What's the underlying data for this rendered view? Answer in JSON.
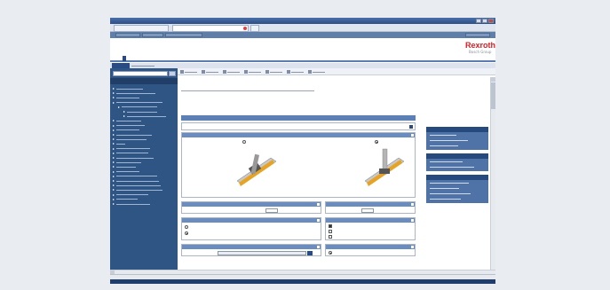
{
  "window": {
    "title": "",
    "tabs": [
      "",
      ""
    ]
  },
  "bookmarks": [
    "",
    "",
    "",
    ""
  ],
  "header": {
    "brand": "Rexroth",
    "brand_sub": "Bosch Group"
  },
  "main_nav": [
    "",
    "",
    "",
    "",
    ""
  ],
  "left_panel": {
    "search_value": "",
    "heading": "",
    "items": [
      {
        "level": 0
      },
      {
        "level": 0
      },
      {
        "level": 0
      },
      {
        "level": 0
      },
      {
        "level": 1
      },
      {
        "level": 2
      },
      {
        "level": 2
      },
      {
        "level": 0
      },
      {
        "level": 0
      },
      {
        "level": 0
      },
      {
        "level": 0
      },
      {
        "level": 0
      },
      {
        "level": 0
      },
      {
        "level": 0
      },
      {
        "level": 0
      },
      {
        "level": 0
      },
      {
        "level": 0
      },
      {
        "level": 0
      },
      {
        "level": 0
      },
      {
        "level": 0
      },
      {
        "level": 0
      },
      {
        "level": 0
      },
      {
        "level": 0
      },
      {
        "level": 0
      },
      {
        "level": 0
      },
      {
        "level": 0
      }
    ]
  },
  "toolbar": {
    "count": 7
  },
  "content": {
    "breadcrumb": "",
    "title": "",
    "band": "",
    "params_title": "",
    "type_panel": {
      "title": "",
      "opt_left": "",
      "opt_right": ""
    },
    "stroke_panel": {
      "title": "",
      "unit": ""
    },
    "load_panel": {
      "title": "",
      "unit": ""
    },
    "drive_panel": {
      "title": "",
      "opt1": "",
      "opt2": ""
    },
    "material_panel": {
      "title": "",
      "opt1": "",
      "opt2": "",
      "opt3": ""
    },
    "control_panel": {
      "title": "",
      "select": ""
    },
    "dynamic_panel": {
      "title": "",
      "opt1": ""
    }
  },
  "right_sidebar": {
    "boxes": [
      {
        "lines": 3
      },
      {
        "lines": 2
      },
      {
        "lines": 4
      }
    ]
  },
  "status": {
    "text": "",
    "tray": ""
  },
  "colors": {
    "accent": "#2f5584",
    "brand": "#d42027",
    "panel_header": "#6a8cbe"
  },
  "icons": [
    "search-icon",
    "close-icon",
    "help-icon",
    "scroll-arrow-icon"
  ]
}
